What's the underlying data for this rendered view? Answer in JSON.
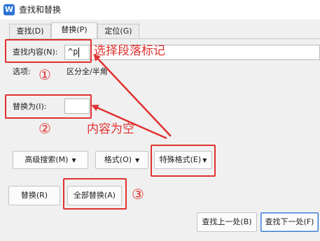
{
  "window": {
    "title": "查找和替换",
    "icon_label": "W"
  },
  "tabs": [
    {
      "label": "查找(D)",
      "active": false
    },
    {
      "label": "替换(P)",
      "active": true
    },
    {
      "label": "定位(G)",
      "active": false
    }
  ],
  "find": {
    "label": "查找内容(N):",
    "value": "^p"
  },
  "options": {
    "label": "选项:",
    "value": "区分全/半角"
  },
  "replace": {
    "label": "替换为(I):",
    "value": ""
  },
  "buttons": {
    "advanced_search": "高级搜索(M)",
    "format": "格式(O)",
    "special_format": "特殊格式(E)",
    "replace": "替换(R)",
    "replace_all": "全部替换(A)",
    "find_prev": "查找上一处(B)",
    "find_next": "查找下一处(F)"
  },
  "annotations": {
    "select_para_mark": "选择段落标记",
    "content_empty": "内容为空",
    "step1": "①",
    "step2": "②",
    "step3": "③"
  },
  "colors": {
    "annotation": "#e0312f",
    "accent": "#2b73d8"
  }
}
